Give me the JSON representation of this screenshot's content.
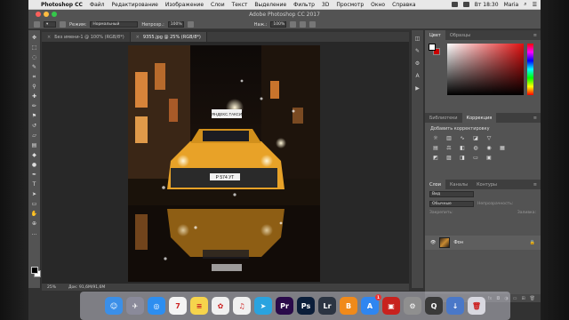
{
  "menubar": {
    "app_name": "Photoshop CC",
    "items": [
      "Файл",
      "Редактирование",
      "Изображение",
      "Слои",
      "Текст",
      "Выделение",
      "Фильтр",
      "3D",
      "Просмотр",
      "Окно",
      "Справка"
    ],
    "clock": "Вт 18:30",
    "user": "Maria"
  },
  "window": {
    "title": "Adobe Photoshop CC 2017"
  },
  "options": {
    "mode_label": "Режим:",
    "mode_value": "Нормальный",
    "opacity_label": "Непрозр.:",
    "opacity_value": "100%",
    "pressure_label": "Наж.:",
    "pressure_value": "100%"
  },
  "tabs": [
    {
      "label": "Без имени-1 @ 100% (RGB/8*)",
      "active": false
    },
    {
      "label": "9355.jpg @ 25% (RGB/8*)",
      "active": true
    }
  ],
  "photo": {
    "taxi_sign": "ЯНДЕКС.ТАКСИ",
    "plate": "Р 574 УТ"
  },
  "status": {
    "zoom": "25%",
    "doc": "Док: 91,6M/91,6M"
  },
  "panels": {
    "color_tabs": [
      "Цвет",
      "Образцы"
    ],
    "adjust_tabs": [
      "Библиотеки",
      "Коррекция"
    ],
    "adjust_title": "Добавить корректировку",
    "layers_tabs": [
      "Слои",
      "Каналы",
      "Контуры"
    ],
    "layers_search": "Вид",
    "blend_mode": "Обычные",
    "opacity_label": "Непрозрачность:",
    "lock_label": "Закрепить:",
    "fill_label": "Заливка:",
    "layer_name": "Фон"
  },
  "dock": {
    "apps": [
      {
        "name": "Finder",
        "color": "#3b8fe8",
        "glyph": "☺"
      },
      {
        "name": "Launchpad",
        "color": "#8a8a9a",
        "glyph": "✈"
      },
      {
        "name": "Safari",
        "color": "#2d8ef0",
        "glyph": "◎"
      },
      {
        "name": "Calendar",
        "color": "#f4f4f4",
        "glyph": "7"
      },
      {
        "name": "Notes",
        "color": "#f6d44c",
        "glyph": "≡"
      },
      {
        "name": "Photos",
        "color": "#f0f0f0",
        "glyph": "✿"
      },
      {
        "name": "iTunes",
        "color": "#f0f0f0",
        "glyph": "♫"
      },
      {
        "name": "Telegram",
        "color": "#2aa3df",
        "glyph": "➤"
      },
      {
        "name": "Premiere",
        "color": "#2a0a4a",
        "glyph": "Pr"
      },
      {
        "name": "Photoshop",
        "color": "#0b1e3a",
        "glyph": "Ps"
      },
      {
        "name": "Lightroom",
        "color": "#2b3442",
        "glyph": "Lr"
      },
      {
        "name": "Books",
        "color": "#f08a1a",
        "glyph": "B"
      },
      {
        "name": "App Store",
        "color": "#2f86f0",
        "glyph": "A",
        "badge": "1"
      },
      {
        "name": "Photo Booth",
        "color": "#c8221e",
        "glyph": "▣"
      },
      {
        "name": "System Preferences",
        "color": "#8f8f8f",
        "glyph": "⚙"
      },
      {
        "name": "QuickTime",
        "color": "#3a3a3a",
        "glyph": "Q"
      },
      {
        "name": "Downloads",
        "color": "#4a78c8",
        "glyph": "↓"
      },
      {
        "name": "Trash",
        "color": "#d8d8e0",
        "glyph": "🗑"
      }
    ]
  }
}
